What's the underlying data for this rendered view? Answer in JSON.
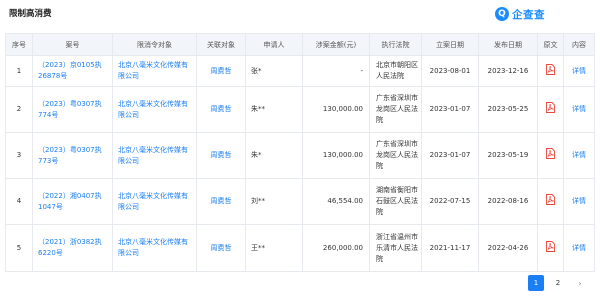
{
  "header": {
    "title": "限制高消费",
    "brand_name": "企查查",
    "brand_icon": "qichacha-logo-icon",
    "brand_color": "#1a8cff"
  },
  "table": {
    "columns": [
      "序号",
      "案号",
      "限消令对象",
      "关联对象",
      "申请人",
      "涉案金额(元)",
      "执行法院",
      "立案日期",
      "发布日期",
      "原文",
      "内容"
    ],
    "rows": [
      {
        "index": "1",
        "case_no": "（2023）京0105执26878号",
        "target": "北京八毫米文化传媒有限公司",
        "related": "周费哲",
        "applicant": "张*",
        "amount": "-",
        "court": "北京市朝阳区人民法院",
        "filed": "2023-08-01",
        "published": "2023-12-16",
        "doc_icon": "pdf-icon",
        "detail": "详情"
      },
      {
        "index": "2",
        "case_no": "（2023）粤0307执774号",
        "target": "北京八毫米文化传媒有限公司",
        "related": "周费哲",
        "applicant": "朱**",
        "amount": "130,000.00",
        "court": "广东省深圳市龙岗区人民法院",
        "filed": "2023-01-07",
        "published": "2023-05-25",
        "doc_icon": "pdf-icon",
        "detail": "详情"
      },
      {
        "index": "3",
        "case_no": "（2023）粤0307执773号",
        "target": "北京八毫米文化传媒有限公司",
        "related": "周费哲",
        "applicant": "朱*",
        "amount": "130,000.00",
        "court": "广东省深圳市龙岗区人民法院",
        "filed": "2023-01-07",
        "published": "2023-05-19",
        "doc_icon": "pdf-icon",
        "detail": "详情"
      },
      {
        "index": "4",
        "case_no": "（2022）湘0407执1047号",
        "target": "北京八毫米文化传媒有限公司",
        "related": "周费哲",
        "applicant": "刘**",
        "amount": "46,554.00",
        "court": "湖南省衡阳市石鼓区人民法院",
        "filed": "2022-07-15",
        "published": "2022-08-16",
        "doc_icon": "pdf-icon",
        "detail": "详情"
      },
      {
        "index": "5",
        "case_no": "（2021）浙0382执6220号",
        "target": "北京八毫米文化传媒有限公司",
        "related": "周费哲",
        "applicant": "王**",
        "amount": "260,000.00",
        "court": "浙江省温州市乐清市人民法院",
        "filed": "2021-11-17",
        "published": "2022-04-26",
        "doc_icon": "pdf-icon",
        "detail": "详情"
      }
    ]
  },
  "pager": {
    "pages": [
      "1",
      "2"
    ],
    "current": "1",
    "next": "›"
  },
  "colors": {
    "link": "#1a7ef5",
    "header_bg": "#f2f5fa",
    "pdf_red": "#e8463b"
  }
}
